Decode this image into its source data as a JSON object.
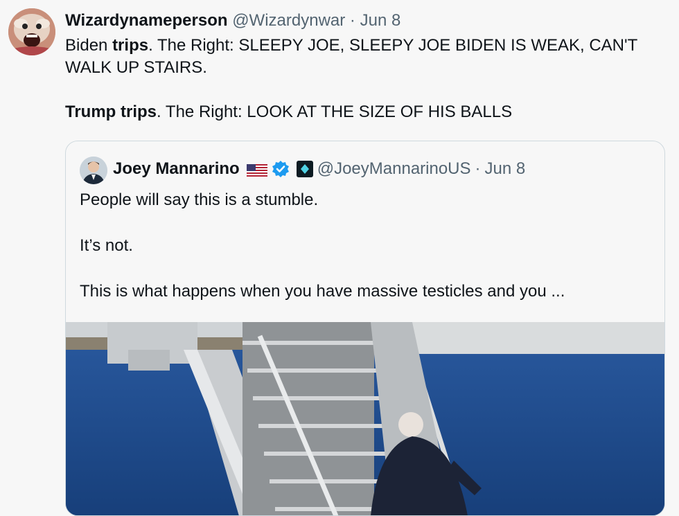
{
  "tweet": {
    "display_name": "Wizardynameperson",
    "handle": "@Wizardynwar",
    "separator": "·",
    "date": "Jun 8",
    "text": {
      "line1_pre": "Biden ",
      "line1_bold": "trips",
      "line1_post": ". The Right: SLEEPY JOE, SLEEPY JOE BIDEN IS WEAK, CAN'T WALK UP STAIRS.",
      "line2_bold": "Trump trips",
      "line2_post": ". The Right: LOOK AT THE SIZE OF HIS BALLS"
    }
  },
  "quoted": {
    "display_name": "Joey Mannarino",
    "handle": "@JoeyMannarinoUS",
    "separator": "·",
    "date": "Jun 8",
    "flag_icon": "us-flag-icon",
    "verified_icon": "verified-badge-icon",
    "affiliate_icon": "affiliate-badge-icon",
    "text": {
      "p1": "People will say this is a stumble.",
      "p2": "It’s not.",
      "p3": "This is what happens when you have massive testicles and you ..."
    }
  },
  "colors": {
    "background": "#f7f7f7",
    "text": "#0f1419",
    "muted": "#536471",
    "border": "#cfd9de",
    "verified": "#1d9bf0"
  }
}
